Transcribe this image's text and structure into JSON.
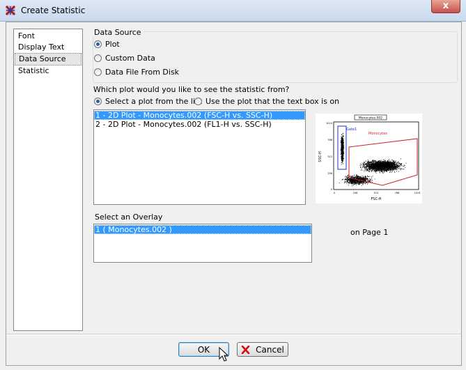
{
  "window": {
    "title": "Create Statistic",
    "close_glyph": "x"
  },
  "nav": {
    "items": [
      {
        "label": "Font",
        "selected": false
      },
      {
        "label": "Display Text",
        "selected": false
      },
      {
        "label": "Data Source",
        "selected": true
      },
      {
        "label": "Statistic",
        "selected": false
      }
    ]
  },
  "data_source": {
    "group_title": "Data Source",
    "options": [
      {
        "label": "Plot",
        "checked": true
      },
      {
        "label": "Custom Data",
        "checked": false
      },
      {
        "label": "Data File From Disk",
        "checked": false
      }
    ]
  },
  "plot_question": "Which plot would you like to see the statistic from?",
  "plot_mode": {
    "options": [
      {
        "label": "Select a plot from the list",
        "checked": true
      },
      {
        "label": "Use the plot that the text box is on",
        "checked": false
      }
    ]
  },
  "plots": {
    "items": [
      {
        "label": "1 - 2D Plot - Monocytes.002 (FSC-H vs. SSC-H)",
        "selected": true
      },
      {
        "label": "2 - 2D Plot - Monocytes.002 (FL1-H vs. SSC-H)",
        "selected": false
      }
    ]
  },
  "thumbnail": {
    "title": "Monocytes.002",
    "xlabel": "FSC-H",
    "ylabel": "SSC-H",
    "gate1": "Gate1",
    "gate2": "Monocytes",
    "yticks": [
      "1024",
      "768",
      "512",
      "256",
      "0"
    ],
    "xticks": [
      "0",
      "256",
      "512",
      "768",
      "1024"
    ]
  },
  "overlay": {
    "label": "Select an Overlay",
    "items": [
      {
        "label": "1 ( Monocytes.002 )",
        "selected": true
      }
    ]
  },
  "page_label": "on Page 1",
  "buttons": {
    "ok": "OK",
    "cancel": "Cancel"
  },
  "colors": {
    "selection": "#3399ff",
    "gate_blue": "#1f2fd0",
    "gate_red": "#d01f2f",
    "cancel_icon": "#d01010"
  }
}
